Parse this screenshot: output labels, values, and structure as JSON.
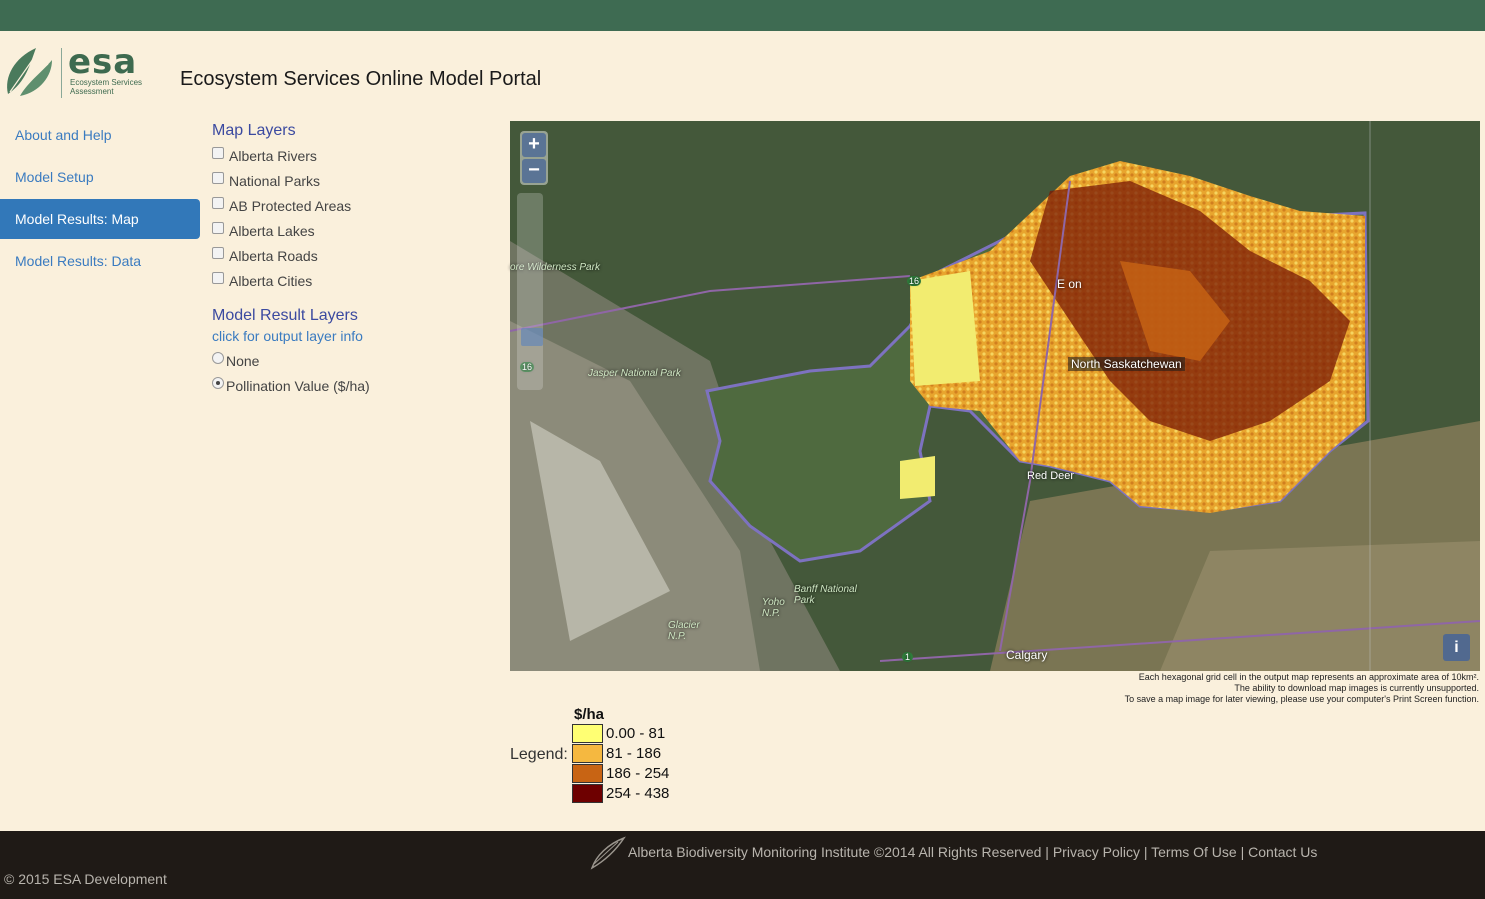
{
  "header": {
    "logo_text": "esa",
    "logo_subtitle": "Ecosystem Services Assessment",
    "title": "Ecosystem Services Online Model Portal"
  },
  "nav": {
    "items": [
      {
        "label": "About and Help"
      },
      {
        "label": "Model Setup"
      },
      {
        "label": "Model Results: Map",
        "active": true
      },
      {
        "label": "Model Results: Data"
      }
    ]
  },
  "map_layers": {
    "title": "Map Layers",
    "items": [
      {
        "label": "Alberta Rivers",
        "checked": false
      },
      {
        "label": "National Parks",
        "checked": false
      },
      {
        "label": "AB Protected Areas",
        "checked": false
      },
      {
        "label": "Alberta Lakes",
        "checked": false
      },
      {
        "label": "Alberta Roads",
        "checked": false
      },
      {
        "label": "Alberta Cities",
        "checked": false
      }
    ]
  },
  "model_result_layers": {
    "title": "Model Result Layers",
    "info_link": "click for output layer info",
    "options": [
      {
        "label": "None",
        "selected": false
      },
      {
        "label": "Pollination Value ($/ha)",
        "selected": true
      }
    ]
  },
  "map": {
    "zoom_in": "+",
    "zoom_out": "−",
    "info_button": "i",
    "labels": {
      "region": "North Saskatchewan",
      "red_deer": "Red Deer",
      "calgary": "Calgary",
      "jasper": "Jasper National Park",
      "banff": "Banff National Park",
      "yoho": "Yoho N.P.",
      "glacier": "Glacier N.P.",
      "wilderness": "ore Wilderness Park",
      "edmonton": "E          on",
      "hwy16a": "16",
      "hwy16b": "16",
      "hwy1": "1"
    },
    "notes": [
      "Each hexagonal grid cell in the output map represents an approximate area of 10km².",
      "The ability to download map images is currently unsupported.",
      "To save a map image for later viewing, please use your computer's Print Screen function."
    ]
  },
  "legend": {
    "label": "Legend:",
    "unit": "$/ha",
    "classes": [
      {
        "range": "0.00 - 81",
        "color": "#ffff73"
      },
      {
        "range": "81 - 186",
        "color": "#f5b840"
      },
      {
        "range": "186 - 254",
        "color": "#c86414"
      },
      {
        "range": "254 - 438",
        "color": "#6e0000"
      }
    ]
  },
  "footer": {
    "org": "Alberta Biodiversity Monitoring Institute ©2014 All Rights Reserved",
    "sep": "|",
    "privacy": "Privacy Policy",
    "terms": "Terms Of Use",
    "contact": "Contact Us",
    "copyright": "© 2015 ESA Development"
  }
}
